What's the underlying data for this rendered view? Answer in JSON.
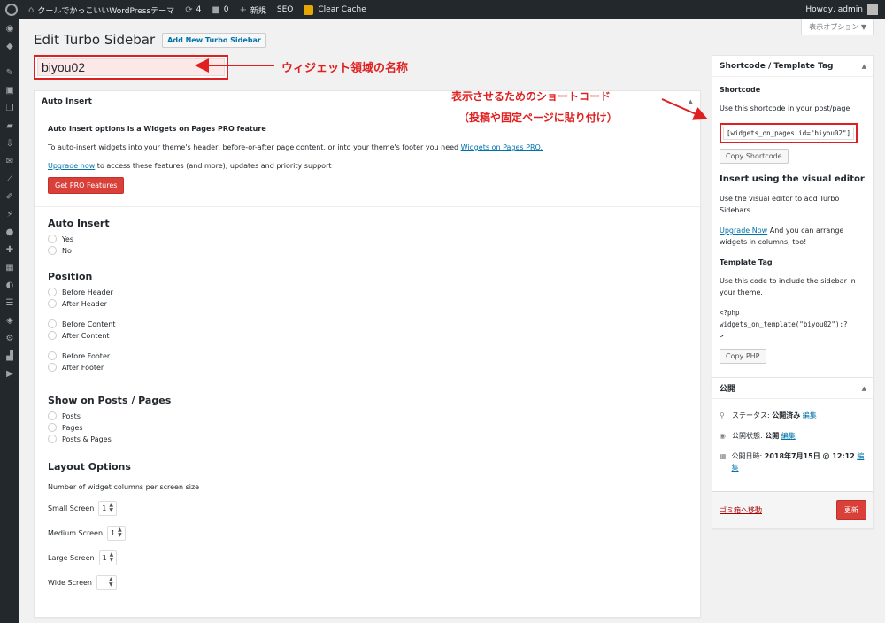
{
  "adminbar": {
    "site_name": "クールでかっこいいWordPressテーマ",
    "updates": "4",
    "comments": "0",
    "new_label": "新規",
    "seo_label": "SEO",
    "clear_cache": "Clear Cache",
    "howdy": "Howdy, admin"
  },
  "screen_options": "表示オプション ▼",
  "page": {
    "title": "Edit Turbo Sidebar",
    "add_new": "Add New Turbo Sidebar",
    "title_value": "biyou02"
  },
  "annotations": {
    "title_note": "ウィジェット領域の名称",
    "shortcode_note_1": "表示させるためのショートコード",
    "shortcode_note_2": "（投稿や固定ページに貼り付け）",
    "color": "#e02020"
  },
  "auto_insert_box": {
    "header": "Auto Insert",
    "pro_note": "Auto Insert options is a Widgets on Pages PRO feature",
    "pro_desc_prefix": "To auto-insert widgets into your theme's header, before-or-after page content, or into your theme's footer you need ",
    "pro_desc_link": "Widgets on Pages PRO.",
    "upgrade_link": "Upgrade now",
    "upgrade_suffix": " to access these features (and more), updates and priority support",
    "pro_button": "Get PRO Features",
    "sections": {
      "auto_insert": {
        "title": "Auto Insert",
        "options": [
          "Yes",
          "No"
        ]
      },
      "position": {
        "title": "Position",
        "options": [
          "Before Header",
          "After Header",
          "Before Content",
          "After Content",
          "Before Footer",
          "After Footer"
        ]
      },
      "show_on": {
        "title": "Show on Posts / Pages",
        "options": [
          "Posts",
          "Pages",
          "Posts & Pages"
        ]
      }
    },
    "layout": {
      "title": "Layout Options",
      "desc": "Number of widget columns per screen size",
      "rows": [
        {
          "label": "Small Screen",
          "value": "1"
        },
        {
          "label": "Medium Screen",
          "value": "1"
        },
        {
          "label": "Large Screen",
          "value": "1"
        },
        {
          "label": "Wide Screen",
          "value": ""
        }
      ]
    }
  },
  "shortcode_box": {
    "header": "Shortcode / Template Tag",
    "shortcode_title": "Shortcode",
    "shortcode_desc": "Use this shortcode in your post/page",
    "shortcode_value": "[widgets_on_pages id=\"biyou02\"]",
    "copy_shortcode": "Copy Shortcode",
    "visual_title": "Insert using the visual editor",
    "visual_desc": "Use the visual editor to add Turbo Sidebars.",
    "visual_upgrade_link": "Upgrade Now",
    "visual_upgrade_suffix": " And you can arrange widgets in columns, too!",
    "template_title": "Template Tag",
    "template_desc": "Use this code to include the sidebar in your theme.",
    "template_code_1": "<?php",
    "template_code_2": "widgets_on_template(\"biyou02\");?",
    "template_code_3": ">",
    "copy_php": "Copy PHP"
  },
  "publish_box": {
    "header": "公開",
    "status_label": "ステータス: ",
    "status_value": "公開済み",
    "edit": "編集",
    "visibility_label": "公開状態: ",
    "visibility_value": "公開",
    "date_label": "公開日時: ",
    "date_value": "2018年7月15日 @ 12:12",
    "trash": "ゴミ箱へ移動",
    "update": "更新"
  }
}
